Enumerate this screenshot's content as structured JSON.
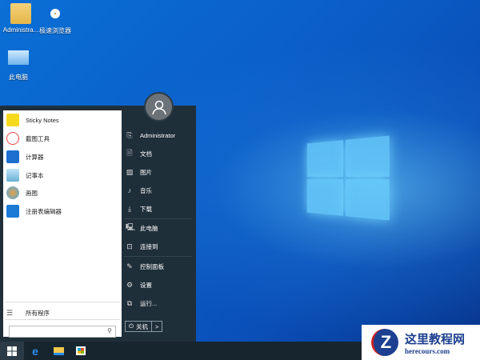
{
  "desktop": {
    "icons": [
      {
        "label": "Administra..."
      },
      {
        "label": "极速浏览器"
      },
      {
        "label": "此电脑"
      }
    ]
  },
  "start_menu": {
    "apps": [
      {
        "label": "Sticky Notes",
        "color": "#f7d91c"
      },
      {
        "label": "截图工具",
        "color": "#e44"
      },
      {
        "label": "计算器",
        "color": "#1e6fd0"
      },
      {
        "label": "记事本",
        "color": "#6ab0d8"
      },
      {
        "label": "画图",
        "color": "#e8a040"
      },
      {
        "label": "注册表编辑器",
        "color": "#1a7ad6"
      }
    ],
    "all_programs": "所有程序",
    "search_placeholder": "",
    "right": [
      {
        "label": "Administrator",
        "icon": "user-doc-icon",
        "glyph": "⎘"
      },
      {
        "label": "文档",
        "icon": "document-icon",
        "glyph": "🗎"
      },
      {
        "label": "图片",
        "icon": "picture-icon",
        "glyph": "▨"
      },
      {
        "label": "音乐",
        "icon": "music-icon",
        "glyph": "♪"
      },
      {
        "label": "下载",
        "icon": "download-icon",
        "glyph": "⤓"
      },
      {
        "label": "此电脑",
        "icon": "computer-icon",
        "glyph": "🖳"
      },
      {
        "label": "连接到",
        "icon": "connect-icon",
        "glyph": "⊡"
      },
      {
        "label": "控制面板",
        "icon": "wrench-icon",
        "glyph": "✎"
      },
      {
        "label": "设置",
        "icon": "gear-icon",
        "glyph": "⚙"
      },
      {
        "label": "运行...",
        "icon": "run-icon",
        "glyph": "⧉"
      }
    ],
    "shutdown": "关机",
    "shutdown_arrow": ">"
  },
  "watermark": {
    "title": "这里教程网",
    "url": "herecours.com"
  }
}
